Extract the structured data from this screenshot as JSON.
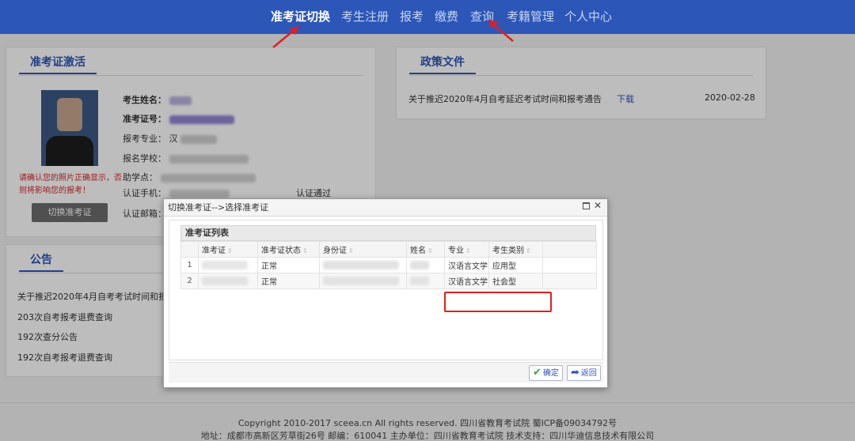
{
  "nav": {
    "items": [
      {
        "label": "准考证切换",
        "active": true
      },
      {
        "label": "考生注册",
        "active": false
      },
      {
        "label": "报考",
        "active": false
      },
      {
        "label": "缴费",
        "active": false
      },
      {
        "label": "查询",
        "active": false
      },
      {
        "label": "考籍管理",
        "active": false
      },
      {
        "label": "个人中心",
        "active": false
      }
    ]
  },
  "activation": {
    "title": "准考证激活",
    "name_label": "考生姓名：",
    "ticket_label": "准考证号：",
    "major_label": "报考专业：",
    "major_partial": "汉",
    "school_label": "报名学校：",
    "assist_label": "助学点：",
    "phone_label": "认证手机：",
    "phone_status": "认证通过",
    "email_label": "认证邮箱：",
    "photo_warning": "请确认您的照片正确显示，否则将影响您的报考！",
    "switch_button": "切换准考证"
  },
  "policy": {
    "title": "政策文件",
    "items": [
      {
        "text": "关于推迟2020年4月自考延迟考试时间和报考通告",
        "link": "下载",
        "date": "2020-02-28"
      }
    ]
  },
  "notice": {
    "title": "公告",
    "items": [
      "关于推迟2020年4月自考考试时间和报",
      "203次自考报考退费查询",
      "192次查分公告",
      "192次自考报考退费查询"
    ]
  },
  "footer": {
    "line1": "Copyright 2010-2017 sceea.cn All rights reserved. 四川省教育考试院 蜀ICP备09034792号",
    "line2": "地址：成都市高新区芳草街26号 邮编：610041 主办单位：四川省教育考试院 技术支持：四川华迪信息技术有限公司"
  },
  "dialog": {
    "title": "切换准考证-->选择准考证",
    "list_title": "准考证列表",
    "columns": [
      "准考证",
      "准考证状态",
      "身份证",
      "姓名",
      "专业",
      "考生类别"
    ],
    "rows": [
      {
        "num": "1",
        "status": "正常",
        "major": "汉语言文学",
        "category": "应用型"
      },
      {
        "num": "2",
        "status": "正常",
        "major": "汉语言文学",
        "category": "社会型"
      }
    ],
    "confirm_button": "确定",
    "back_button": "返回"
  },
  "colors": {
    "nav_bg": "#2c56b8",
    "accent": "#2c56b8",
    "warning": "#d42525",
    "highlight": "#e02020"
  },
  "icons": [
    "check-icon",
    "back-arrow-icon",
    "maximize-icon",
    "close-icon",
    "sort-icon"
  ]
}
